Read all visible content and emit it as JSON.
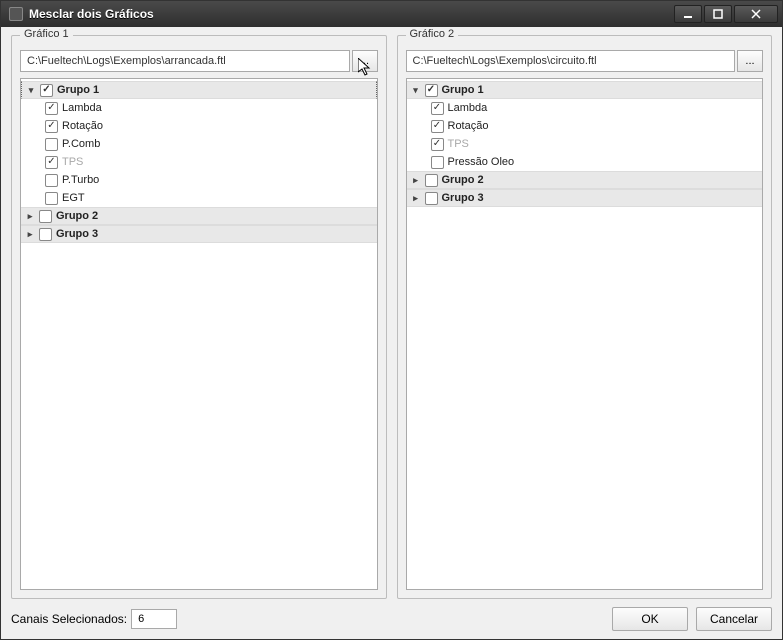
{
  "window": {
    "title": "Mesclar dois Gráficos",
    "buttons": {
      "minimize": "minimize",
      "maximize": "maximize",
      "close": "close"
    }
  },
  "panels": [
    {
      "legend": "Gráfico 1",
      "path": "C:\\Fueltech\\Logs\\Exemplos\\arrancada.ftl",
      "browse": "...",
      "tree": [
        {
          "type": "group",
          "label": "Grupo 1",
          "checked": true,
          "expanded": true,
          "selected": true
        },
        {
          "type": "sub",
          "label": "Lambda",
          "checked": true
        },
        {
          "type": "sub",
          "label": "Rotação",
          "checked": true
        },
        {
          "type": "sub",
          "label": "P.Comb",
          "checked": false
        },
        {
          "type": "sub",
          "label": "TPS",
          "checked": true,
          "disabled": true
        },
        {
          "type": "sub",
          "label": "P.Turbo",
          "checked": false
        },
        {
          "type": "sub",
          "label": "EGT",
          "checked": false
        },
        {
          "type": "group",
          "label": "Grupo 2",
          "checked": false,
          "expanded": false
        },
        {
          "type": "group",
          "label": "Grupo 3",
          "checked": false,
          "expanded": false
        }
      ]
    },
    {
      "legend": "Gráfico 2",
      "path": "C:\\Fueltech\\Logs\\Exemplos\\circuito.ftl",
      "browse": "...",
      "tree": [
        {
          "type": "group",
          "label": "Grupo 1",
          "checked": true,
          "expanded": true
        },
        {
          "type": "sub",
          "label": "Lambda",
          "checked": true
        },
        {
          "type": "sub",
          "label": "Rotação",
          "checked": true
        },
        {
          "type": "sub",
          "label": "TPS",
          "checked": true,
          "disabled": true
        },
        {
          "type": "sub",
          "label": "Pressão Oleo",
          "checked": false
        },
        {
          "type": "group",
          "label": "Grupo 2",
          "checked": false,
          "expanded": false
        },
        {
          "type": "group",
          "label": "Grupo 3",
          "checked": false,
          "expanded": false
        }
      ]
    }
  ],
  "footer": {
    "countLabel": "Canais Selecionados:",
    "countValue": "6",
    "ok": "OK",
    "cancel": "Cancelar"
  }
}
